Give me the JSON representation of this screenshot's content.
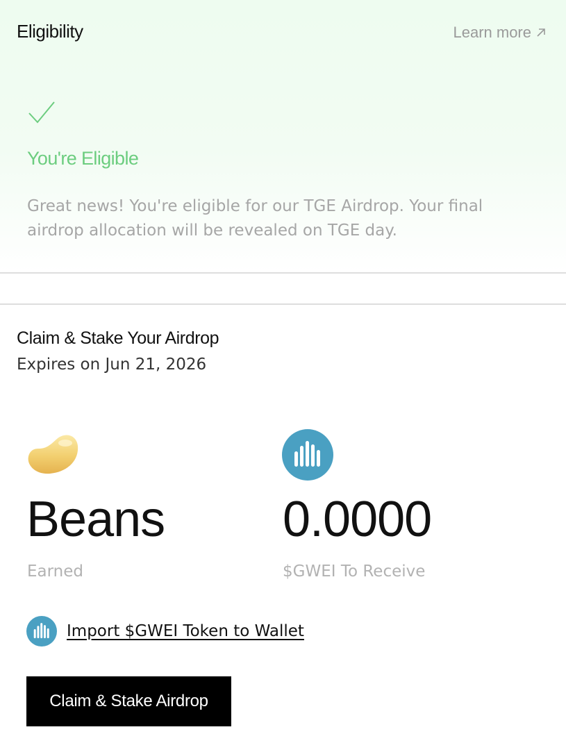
{
  "eligibility": {
    "title": "Eligibility",
    "learn_more_label": "Learn more",
    "learn_more_icon": "arrow-up-right-icon",
    "status_icon": "check-icon",
    "status": "You're Eligible",
    "description": "Great news! You're eligible for our TGE Airdrop. Your final airdrop allocation will be revealed on TGE day.",
    "status_color": "#6ccd7f"
  },
  "claim": {
    "title": "Claim & Stake Your Airdrop",
    "expiry": "Expires on Jun 21, 2026",
    "beans": {
      "icon": "bean-icon",
      "value": "Beans",
      "label": "Earned"
    },
    "gwei": {
      "icon": "gwei-token-icon",
      "value": "0.0000",
      "label": "$GWEI To Receive",
      "color": "#4aa0c2"
    },
    "import_label": "Import $GWEI Token to Wallet",
    "button_label": "Claim & Stake Airdrop"
  }
}
